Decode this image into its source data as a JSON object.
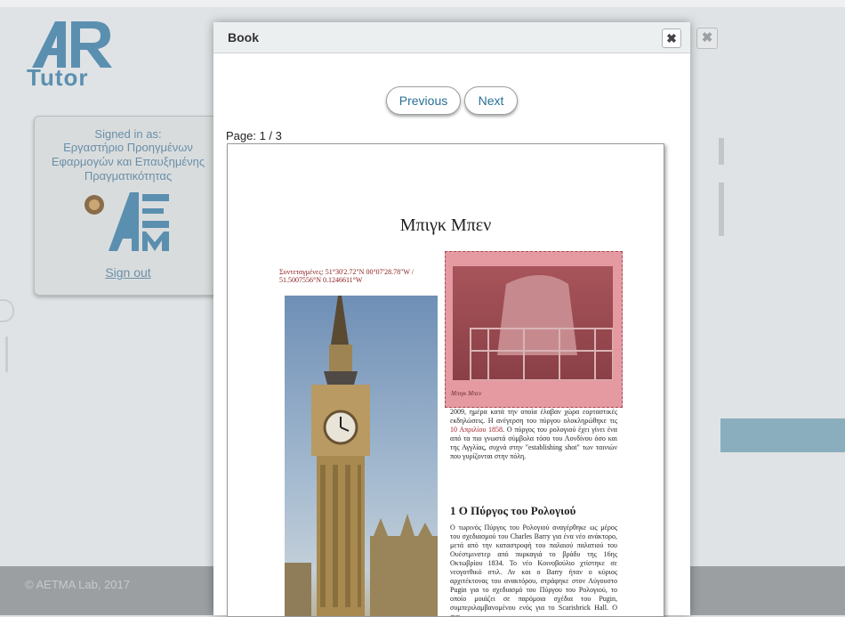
{
  "background": {
    "logo_tutor": "Tutor",
    "signin": {
      "label": "Signed in as:",
      "org": "Εργαστήριο Προηγμένων Εφαρμογών και Επαυξημένης Πραγματικότητας",
      "sign_out": "Sign out"
    },
    "footer": "© AETMA Lab, 2017"
  },
  "dialog": {
    "title": "Book",
    "previous_label": "Previous",
    "next_label": "Next",
    "page_indicator": "Page: 1 / 3",
    "page": {
      "title": "Μπιγκ Μπεν",
      "coords": "Συντεταγμένες: 51°30'2.72\"N 00°07'28.78\"W / 51.5007556°N 0.1246611°W",
      "highlight_caption": "Μπιγκ Μπεν",
      "body_para_a": "2009, ημέρα κατά την οποία έλαβαν χώρα εορταστικές εκδηλώσεις. Η ανέγερση του πύργου ολοκληρώθηκε τις ",
      "body_para_date": "10 Απριλίου 1858",
      "body_para_b": ". Ο πύργος του ρολογιού έχει γίνει ένα από τα πιο γνωστά σύμβολα τόσο του Λονδίνου όσο και της Αγγλίας, συχνά στην \"establishing shot\" των ταινιών που γυρίζονται στην πόλη.",
      "section_title": "1   Ο Πύργος του Ρολογιού",
      "section_a": "Ο τωρινός Πύργος του Ρολογιού αναγέρθηκε ως μέρος του σχεδιασμού του Charles Barry για ένα νέο ανάκτορο, μετά από την καταστροφή του παλαιού παλατιού του Ουέστμινστερ από πυρκαγιά το βράδυ της 16ης Οκτωβρίου 1834. Το νέο Κοινοβούλιο χτίστηκε σε ",
      "section_link": "νεογοτθικό στιλ",
      "section_b": ". Αν και ο Barry ήταν ο κύριος αρχιτέκτονας του ανακτόρου, στράφηκε στον Αύγουστο Pugin για το σχεδιασμό του Πύργου του Ρολογιού, το οποίο μοιάζει σε παρόμοια σχέδια του Pugin, συμπεριλαμβανομένου ενός για το Scarisbrick Hall. Ο σχε-"
    }
  },
  "colors": {
    "accent": "#2a6f96",
    "highlight": "#e59aa2"
  }
}
